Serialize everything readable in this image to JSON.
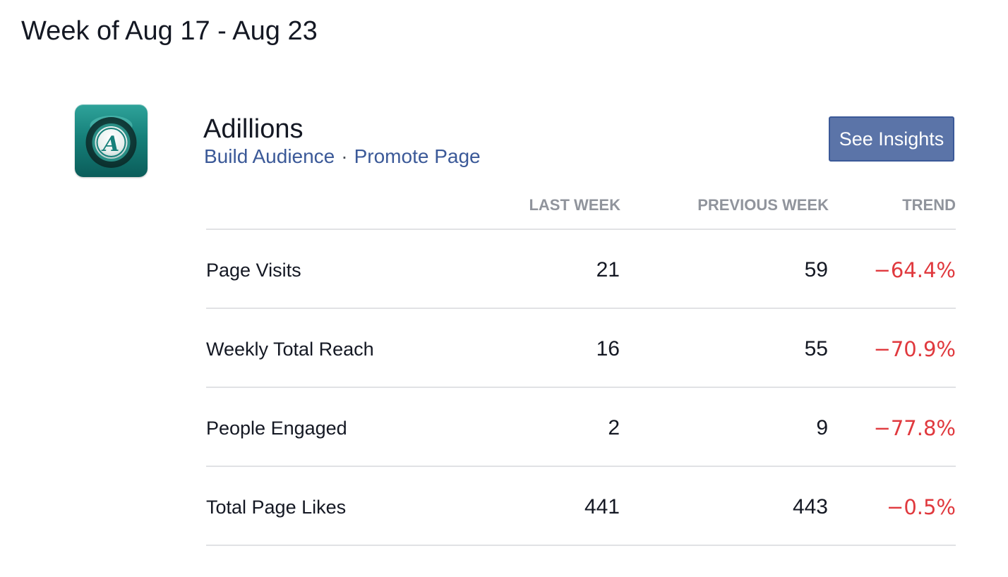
{
  "header": {
    "week_title": "Week of Aug 17 - Aug 23"
  },
  "page": {
    "name": "Adillions",
    "logo_letter": "A",
    "build_audience_label": "Build Audience",
    "separator": "·",
    "promote_page_label": "Promote Page",
    "see_insights_label": "See Insights"
  },
  "stats": {
    "columns": {
      "last_week": "LAST WEEK",
      "previous_week": "PREVIOUS WEEK",
      "trend": "TREND"
    },
    "rows": [
      {
        "label": "Page Visits",
        "last_week": "21",
        "previous_week": "59",
        "trend": "−64.4%"
      },
      {
        "label": "Weekly Total Reach",
        "last_week": "16",
        "previous_week": "55",
        "trend": "−70.9%"
      },
      {
        "label": "People Engaged",
        "last_week": "2",
        "previous_week": "9",
        "trend": "−77.8%"
      },
      {
        "label": "Total Page Likes",
        "last_week": "441",
        "previous_week": "443",
        "trend": "−0.5%"
      }
    ]
  },
  "colors": {
    "link": "#3b5998",
    "button_bg": "#5b74a8",
    "trend_negative": "#e0393e",
    "column_header": "#90949c",
    "logo_teal": "#16807a"
  },
  "icons": {
    "logo": "adillions-logo-icon"
  }
}
